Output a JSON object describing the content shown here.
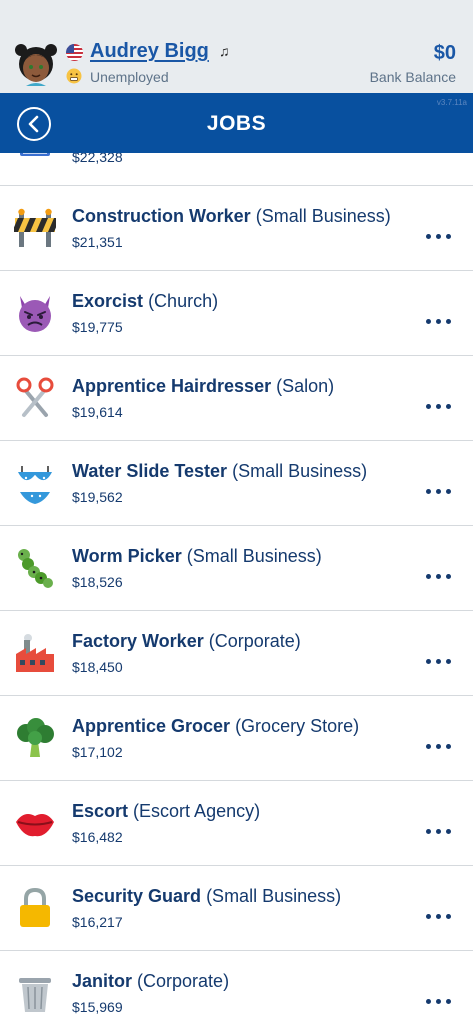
{
  "header": {
    "name": "Audrey Bigg",
    "music_symbol": "♫",
    "status": "Unemployed",
    "balance": "$0",
    "balance_label": "Bank Balance"
  },
  "nav": {
    "title": "JOBS",
    "version": "v3.7.11a"
  },
  "jobs": [
    {
      "title": "",
      "employer": "",
      "salary": "$22,328",
      "icon": "partial-icon"
    },
    {
      "title": "Construction Worker",
      "employer": "(Small Business)",
      "salary": "$21,351",
      "icon": "construction-barrier-icon"
    },
    {
      "title": "Exorcist",
      "employer": "(Church)",
      "salary": "$19,775",
      "icon": "devil-face-icon"
    },
    {
      "title": "Apprentice Hairdresser",
      "employer": "(Salon)",
      "salary": "$19,614",
      "icon": "scissors-icon"
    },
    {
      "title": "Water Slide Tester",
      "employer": "(Small Business)",
      "salary": "$19,562",
      "icon": "bikini-icon"
    },
    {
      "title": "Worm Picker",
      "employer": "(Small Business)",
      "salary": "$18,526",
      "icon": "caterpillar-icon"
    },
    {
      "title": "Factory Worker",
      "employer": "(Corporate)",
      "salary": "$18,450",
      "icon": "factory-icon"
    },
    {
      "title": "Apprentice Grocer",
      "employer": "(Grocery Store)",
      "salary": "$17,102",
      "icon": "broccoli-icon"
    },
    {
      "title": "Escort",
      "employer": "(Escort Agency)",
      "salary": "$16,482",
      "icon": "lips-icon"
    },
    {
      "title": "Security Guard",
      "employer": "(Small Business)",
      "salary": "$16,217",
      "icon": "padlock-icon"
    },
    {
      "title": "Janitor",
      "employer": "(Corporate)",
      "salary": "$15,969",
      "icon": "trash-can-icon"
    }
  ],
  "colors": {
    "accent": "#1a57a6",
    "nav_bg": "#08509f",
    "text_dark": "#153a6e",
    "muted": "#5e7389"
  }
}
